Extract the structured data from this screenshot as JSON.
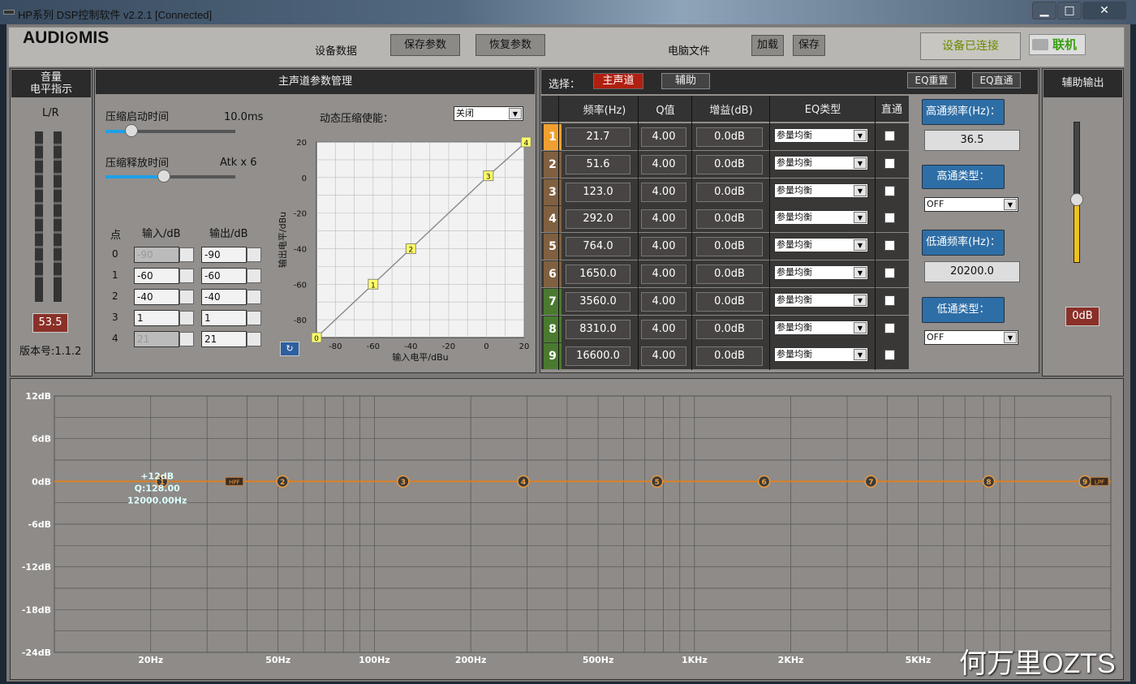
{
  "window": {
    "title": "HP系列 DSP控制软件 v2.2.1 [Connected]",
    "min": "▁",
    "max": "□",
    "close": "✕"
  },
  "brand": {
    "logo": "AUDI⊙MIS"
  },
  "toolbar": {
    "device_label": "设备数据",
    "save_params": "保存参数",
    "restore_params": "恢复参数",
    "pc_file_label": "电脑文件",
    "load": "加载",
    "save": "保存",
    "connected_status": "设备已连接",
    "connect_btn": "联机"
  },
  "volume_panel": {
    "title": "音量",
    "subtitle": "电平指示",
    "channel": "L/R",
    "value": "53.5",
    "version": "版本号:1.1.2"
  },
  "compressor": {
    "title": "主声道参数管理",
    "attack_label": "压缩启动时间",
    "attack_value": "10.0ms",
    "attack_level": 0.2,
    "release_label": "压缩释放时间",
    "release_value": "Atk x 6",
    "release_level": 0.45,
    "enable_label": "动态压缩使能：",
    "enable_value": "关闭",
    "table_headers": {
      "point": "点",
      "input": "输入/dB",
      "output": "输出/dB"
    },
    "points": [
      {
        "idx": "0",
        "input": "-90",
        "output": "-90"
      },
      {
        "idx": "1",
        "input": "-60",
        "output": "-60"
      },
      {
        "idx": "2",
        "input": "-40",
        "output": "-40"
      },
      {
        "idx": "3",
        "input": "1",
        "output": "1"
      },
      {
        "idx": "4",
        "input": "21",
        "output": "21"
      }
    ]
  },
  "chart_data": [
    {
      "type": "line",
      "xlabel": "输入电平/dBu",
      "ylabel": "输出电平/dBu",
      "xlim": [
        -90,
        20
      ],
      "ylim": [
        -90,
        20
      ],
      "x_ticks": [
        "-80",
        "-60",
        "-40",
        "-20",
        "0",
        "20"
      ],
      "y_ticks": [
        "20",
        "0",
        "-20",
        "-40",
        "-60",
        "-80"
      ],
      "points": [
        {
          "label": "0",
          "x": -90,
          "y": -90
        },
        {
          "label": "1",
          "x": -60,
          "y": -60
        },
        {
          "label": "2",
          "x": -40,
          "y": -40
        },
        {
          "label": "3",
          "x": 1,
          "y": 1
        },
        {
          "label": "4",
          "x": 21,
          "y": 21
        }
      ]
    },
    {
      "type": "line",
      "ylim": [
        -24,
        12
      ],
      "y_ticks": [
        "12dB",
        "6dB",
        "0dB",
        "-6dB",
        "-12dB",
        "-18dB",
        "-24dB"
      ],
      "x_ticks": [
        "20Hz",
        "50Hz",
        "100Hz",
        "200Hz",
        "500Hz",
        "1KHz",
        "2KHz",
        "5KHz"
      ],
      "series": [
        {
          "values": [
            0,
            0
          ]
        }
      ],
      "bands": [
        "1",
        "2",
        "3",
        "4",
        "5",
        "6",
        "7",
        "8",
        "9"
      ],
      "hpf": "HPF",
      "lpf": "LPF",
      "tooltip": {
        "line1": "+12dB",
        "line2": "Q:128.00",
        "line3": "12000.00Hz"
      }
    }
  ],
  "eq": {
    "select_label": "选择：",
    "main_tab": "主声道",
    "aux_tab": "辅助",
    "eq_reset": "EQ重置",
    "eq_bypass": "EQ直通",
    "headers": {
      "freq": "频率(Hz)",
      "q": "Q值",
      "gain": "增益(dB)",
      "type": "EQ类型",
      "bypass": "直通"
    },
    "rows": [
      {
        "n": "1",
        "freq": "21.7",
        "q": "4.00",
        "gain": "0.0dB",
        "type": "参量均衡",
        "color": "#f0a030"
      },
      {
        "n": "2",
        "freq": "51.6",
        "q": "4.00",
        "gain": "0.0dB",
        "type": "参量均衡",
        "color": "#806040"
      },
      {
        "n": "3",
        "freq": "123.0",
        "q": "4.00",
        "gain": "0.0dB",
        "type": "参量均衡",
        "color": "#806040"
      },
      {
        "n": "4",
        "freq": "292.0",
        "q": "4.00",
        "gain": "0.0dB",
        "type": "参量均衡",
        "color": "#806040"
      },
      {
        "n": "5",
        "freq": "764.0",
        "q": "4.00",
        "gain": "0.0dB",
        "type": "参量均衡",
        "color": "#806040"
      },
      {
        "n": "6",
        "freq": "1650.0",
        "q": "4.00",
        "gain": "0.0dB",
        "type": "参量均衡",
        "color": "#806040"
      },
      {
        "n": "7",
        "freq": "3560.0",
        "q": "4.00",
        "gain": "0.0dB",
        "type": "参量均衡",
        "color": "#4a7a30"
      },
      {
        "n": "8",
        "freq": "8310.0",
        "q": "4.00",
        "gain": "0.0dB",
        "type": "参量均衡",
        "color": "#4a7a30"
      },
      {
        "n": "9",
        "freq": "16600.0",
        "q": "4.00",
        "gain": "0.0dB",
        "type": "参量均衡",
        "color": "#4a7a30"
      }
    ]
  },
  "filters": {
    "hp_freq_label": "高通频率(Hz)：",
    "hp_freq": "36.5",
    "hp_type_label": "高通类型：",
    "hp_type": "OFF",
    "lp_freq_label": "低通频率(Hz)：",
    "lp_freq": "20200.0",
    "lp_type_label": "低通类型：",
    "lp_type": "OFF"
  },
  "aux_out": {
    "title": "辅助输出",
    "value": "0dB",
    "level": 0.45
  },
  "watermark": "何万里OZTS"
}
